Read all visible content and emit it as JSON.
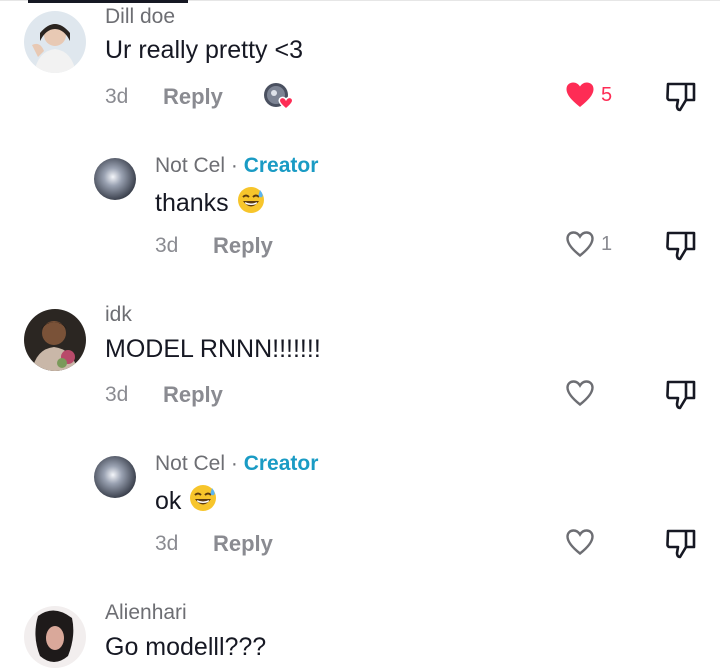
{
  "comments": [
    {
      "username": "Dill doe",
      "text": "Ur really pretty <3",
      "time": "3d",
      "reply_label": "Reply",
      "likes": "5",
      "liked": true,
      "creator_liked": true
    },
    {
      "username": "Not Cel",
      "badge_sep": " · ",
      "badge": "Creator",
      "text": "thanks",
      "emoji": "sweat-smile",
      "time": "3d",
      "reply_label": "Reply",
      "likes": "1"
    },
    {
      "username": "idk",
      "text": "MODEL RNNN!!!!!!!",
      "time": "3d",
      "reply_label": "Reply",
      "likes": ""
    },
    {
      "username": "Not Cel",
      "badge_sep": " · ",
      "badge": "Creator",
      "text": "ok",
      "emoji": "sweat-smile",
      "time": "3d",
      "reply_label": "Reply",
      "likes": ""
    },
    {
      "username": "Alienhari",
      "text": "Go modelll???"
    }
  ],
  "colors": {
    "like_active": "#fe2c55",
    "creator_badge": "#1a9bc4",
    "muted": "#8a8b91"
  },
  "icons": [
    "heart-icon",
    "dislike-icon",
    "creator-liked-icon",
    "sweat-smile-emoji"
  ]
}
